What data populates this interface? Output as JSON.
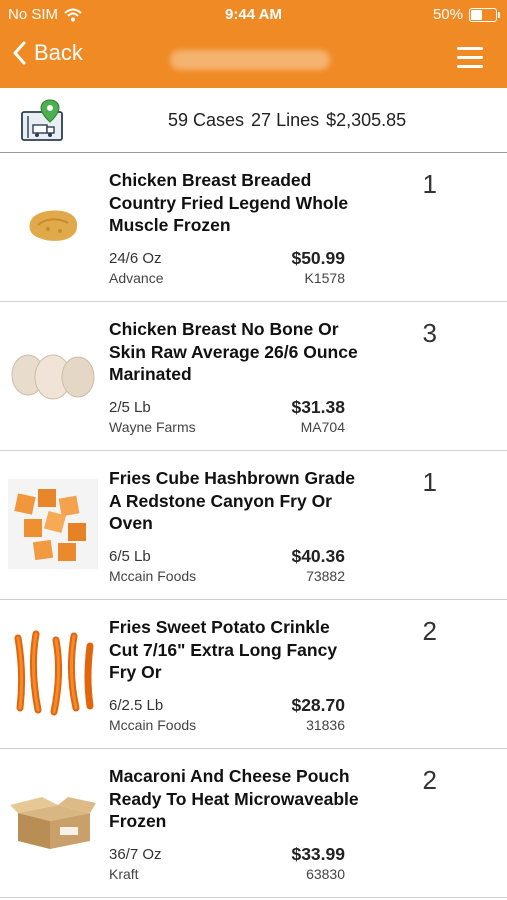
{
  "status_bar": {
    "carrier": "No SIM",
    "time": "9:44 AM",
    "battery": "50%",
    "battery_level": 0.5
  },
  "nav": {
    "back_label": "Back",
    "title": ""
  },
  "summary": {
    "cases": "59 Cases",
    "lines": "27 Lines",
    "total": "$2,305.85"
  },
  "items": [
    {
      "name": "Chicken Breast Breaded Country Fried Legend Whole Muscle Frozen",
      "pack": "24/6 Oz",
      "brand": "Advance",
      "price": "$50.99",
      "code": "K1578",
      "qty": "1",
      "image": "breaded-chicken-image"
    },
    {
      "name": "Chicken Breast No Bone Or Skin Raw Average 26/6 Ounce Marinated",
      "pack": "2/5 Lb",
      "brand": "Wayne Farms",
      "price": "$31.38",
      "code": "MA704",
      "qty": "3",
      "image": "raw-chicken-image"
    },
    {
      "name": "Fries Cube Hashbrown Grade A Redstone Canyon Fry Or Oven",
      "pack": "6/5 Lb",
      "brand": "Mccain Foods",
      "price": "$40.36",
      "code": "73882",
      "qty": "1",
      "image": "cube-fries-image"
    },
    {
      "name": "Fries Sweet Potato Crinkle Cut 7/16\" Extra Long Fancy Fry Or",
      "pack": "6/2.5 Lb",
      "brand": "Mccain Foods",
      "price": "$28.70",
      "code": "31836",
      "qty": "2",
      "image": "sweet-potato-fries-image"
    },
    {
      "name": "Macaroni And Cheese Pouch Ready To Heat Microwaveable Frozen",
      "pack": "36/7 Oz",
      "brand": "Kraft",
      "price": "$33.99",
      "code": "63830",
      "qty": "2",
      "image": "case-box-image"
    }
  ],
  "colors": {
    "accent": "#f08a24"
  }
}
